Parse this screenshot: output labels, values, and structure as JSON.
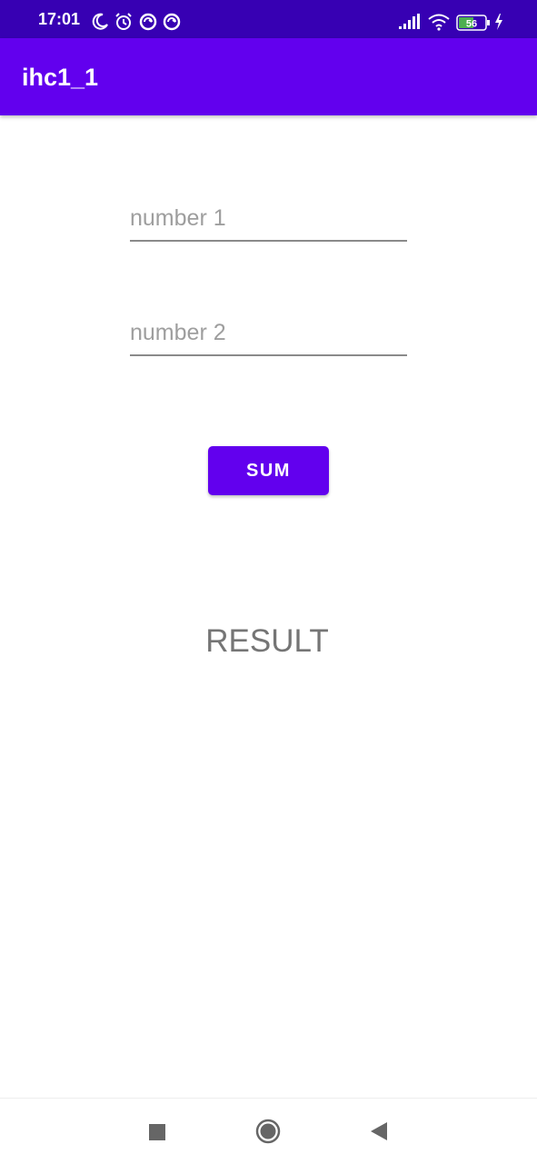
{
  "status_bar": {
    "time": "17:01",
    "battery_level": "56",
    "icons": [
      "moon-icon",
      "alarm-icon",
      "sync-icon",
      "sync-icon",
      "signal-icon",
      "wifi-icon",
      "battery-icon",
      "charging-icon"
    ]
  },
  "app_bar": {
    "title": "ihc1_1"
  },
  "form": {
    "number1_placeholder": "number 1",
    "number2_placeholder": "number 2",
    "sum_label": "SUM",
    "result_text": "RESULT"
  },
  "nav_bar": {
    "icons": [
      "recents-icon",
      "home-icon",
      "back-icon"
    ]
  },
  "colors": {
    "status_bar": "#3700b3",
    "primary": "#6200ee",
    "result_text": "#757575",
    "placeholder": "#9e9e9e"
  }
}
